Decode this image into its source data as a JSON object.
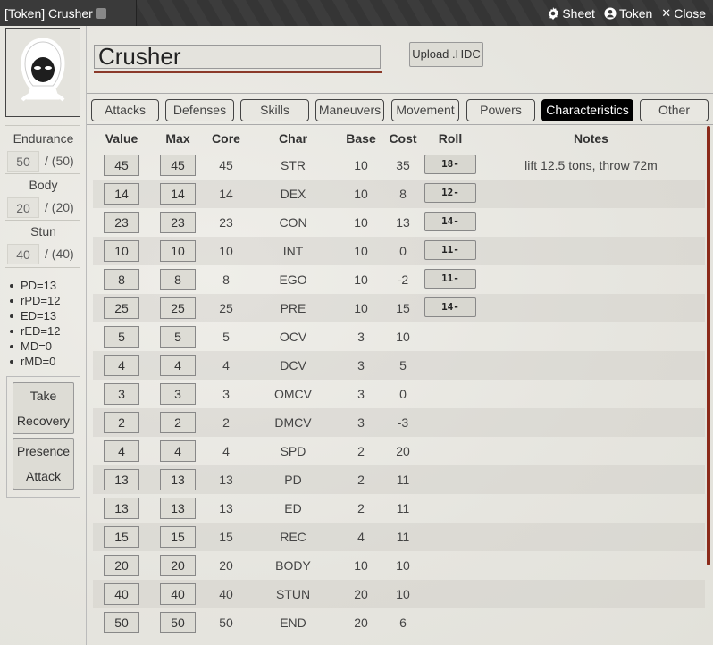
{
  "window": {
    "title": "[Token] Crusher",
    "actions": {
      "sheet": "Sheet",
      "token": "Token",
      "close": "Close"
    }
  },
  "sidebar": {
    "endurance": {
      "label": "Endurance",
      "value": "50",
      "max": "/ (50)"
    },
    "body": {
      "label": "Body",
      "value": "20",
      "max": "/ (20)"
    },
    "stun": {
      "label": "Stun",
      "value": "40",
      "max": "/ (40)"
    },
    "defenses": [
      "PD=13",
      "rPD=12",
      "ED=13",
      "rED=12",
      "MD=0",
      "rMD=0"
    ],
    "buttons": {
      "take_recovery": [
        "Take",
        "Recovery"
      ],
      "presence_attack": [
        "Presence",
        "Attack"
      ]
    }
  },
  "header": {
    "name": "Crusher",
    "upload_label": "Upload .HDC"
  },
  "tabs": [
    {
      "label": "Attacks",
      "active": false
    },
    {
      "label": "Defenses",
      "active": false
    },
    {
      "label": "Skills",
      "active": false
    },
    {
      "label": "Maneuvers",
      "active": false
    },
    {
      "label": "Movement",
      "active": false
    },
    {
      "label": "Powers",
      "active": false
    },
    {
      "label": "Characteristics",
      "active": true
    },
    {
      "label": "Other",
      "active": false
    }
  ],
  "table": {
    "columns": [
      "Value",
      "Max",
      "Core",
      "Char",
      "Base",
      "Cost",
      "Roll",
      "Notes"
    ],
    "rows": [
      {
        "value": "45",
        "max": "45",
        "core": "45",
        "char": "STR",
        "base": "10",
        "cost": "35",
        "roll": "18-",
        "notes": "lift 12.5 tons, throw 72m"
      },
      {
        "value": "14",
        "max": "14",
        "core": "14",
        "char": "DEX",
        "base": "10",
        "cost": "8",
        "roll": "12-",
        "notes": ""
      },
      {
        "value": "23",
        "max": "23",
        "core": "23",
        "char": "CON",
        "base": "10",
        "cost": "13",
        "roll": "14-",
        "notes": ""
      },
      {
        "value": "10",
        "max": "10",
        "core": "10",
        "char": "INT",
        "base": "10",
        "cost": "0",
        "roll": "11-",
        "notes": ""
      },
      {
        "value": "8",
        "max": "8",
        "core": "8",
        "char": "EGO",
        "base": "10",
        "cost": "-2",
        "roll": "11-",
        "notes": ""
      },
      {
        "value": "25",
        "max": "25",
        "core": "25",
        "char": "PRE",
        "base": "10",
        "cost": "15",
        "roll": "14-",
        "notes": ""
      },
      {
        "value": "5",
        "max": "5",
        "core": "5",
        "char": "OCV",
        "base": "3",
        "cost": "10",
        "roll": "",
        "notes": ""
      },
      {
        "value": "4",
        "max": "4",
        "core": "4",
        "char": "DCV",
        "base": "3",
        "cost": "5",
        "roll": "",
        "notes": ""
      },
      {
        "value": "3",
        "max": "3",
        "core": "3",
        "char": "OMCV",
        "base": "3",
        "cost": "0",
        "roll": "",
        "notes": ""
      },
      {
        "value": "2",
        "max": "2",
        "core": "2",
        "char": "DMCV",
        "base": "3",
        "cost": "-3",
        "roll": "",
        "notes": ""
      },
      {
        "value": "4",
        "max": "4",
        "core": "4",
        "char": "SPD",
        "base": "2",
        "cost": "20",
        "roll": "",
        "notes": ""
      },
      {
        "value": "13",
        "max": "13",
        "core": "13",
        "char": "PD",
        "base": "2",
        "cost": "11",
        "roll": "",
        "notes": ""
      },
      {
        "value": "13",
        "max": "13",
        "core": "13",
        "char": "ED",
        "base": "2",
        "cost": "11",
        "roll": "",
        "notes": ""
      },
      {
        "value": "15",
        "max": "15",
        "core": "15",
        "char": "REC",
        "base": "4",
        "cost": "11",
        "roll": "",
        "notes": ""
      },
      {
        "value": "20",
        "max": "20",
        "core": "20",
        "char": "BODY",
        "base": "10",
        "cost": "10",
        "roll": "",
        "notes": ""
      },
      {
        "value": "40",
        "max": "40",
        "core": "40",
        "char": "STUN",
        "base": "20",
        "cost": "10",
        "roll": "",
        "notes": ""
      },
      {
        "value": "50",
        "max": "50",
        "core": "50",
        "char": "END",
        "base": "20",
        "cost": "6",
        "roll": "",
        "notes": ""
      }
    ]
  },
  "icons": {
    "portrait": "hooded-figure-icon",
    "sheet": "gear-icon",
    "token": "user-circle-icon",
    "close": "close-icon",
    "resize": "expand-icon"
  },
  "colors": {
    "accent": "#8b3a2a",
    "active_tab": "#000000"
  }
}
